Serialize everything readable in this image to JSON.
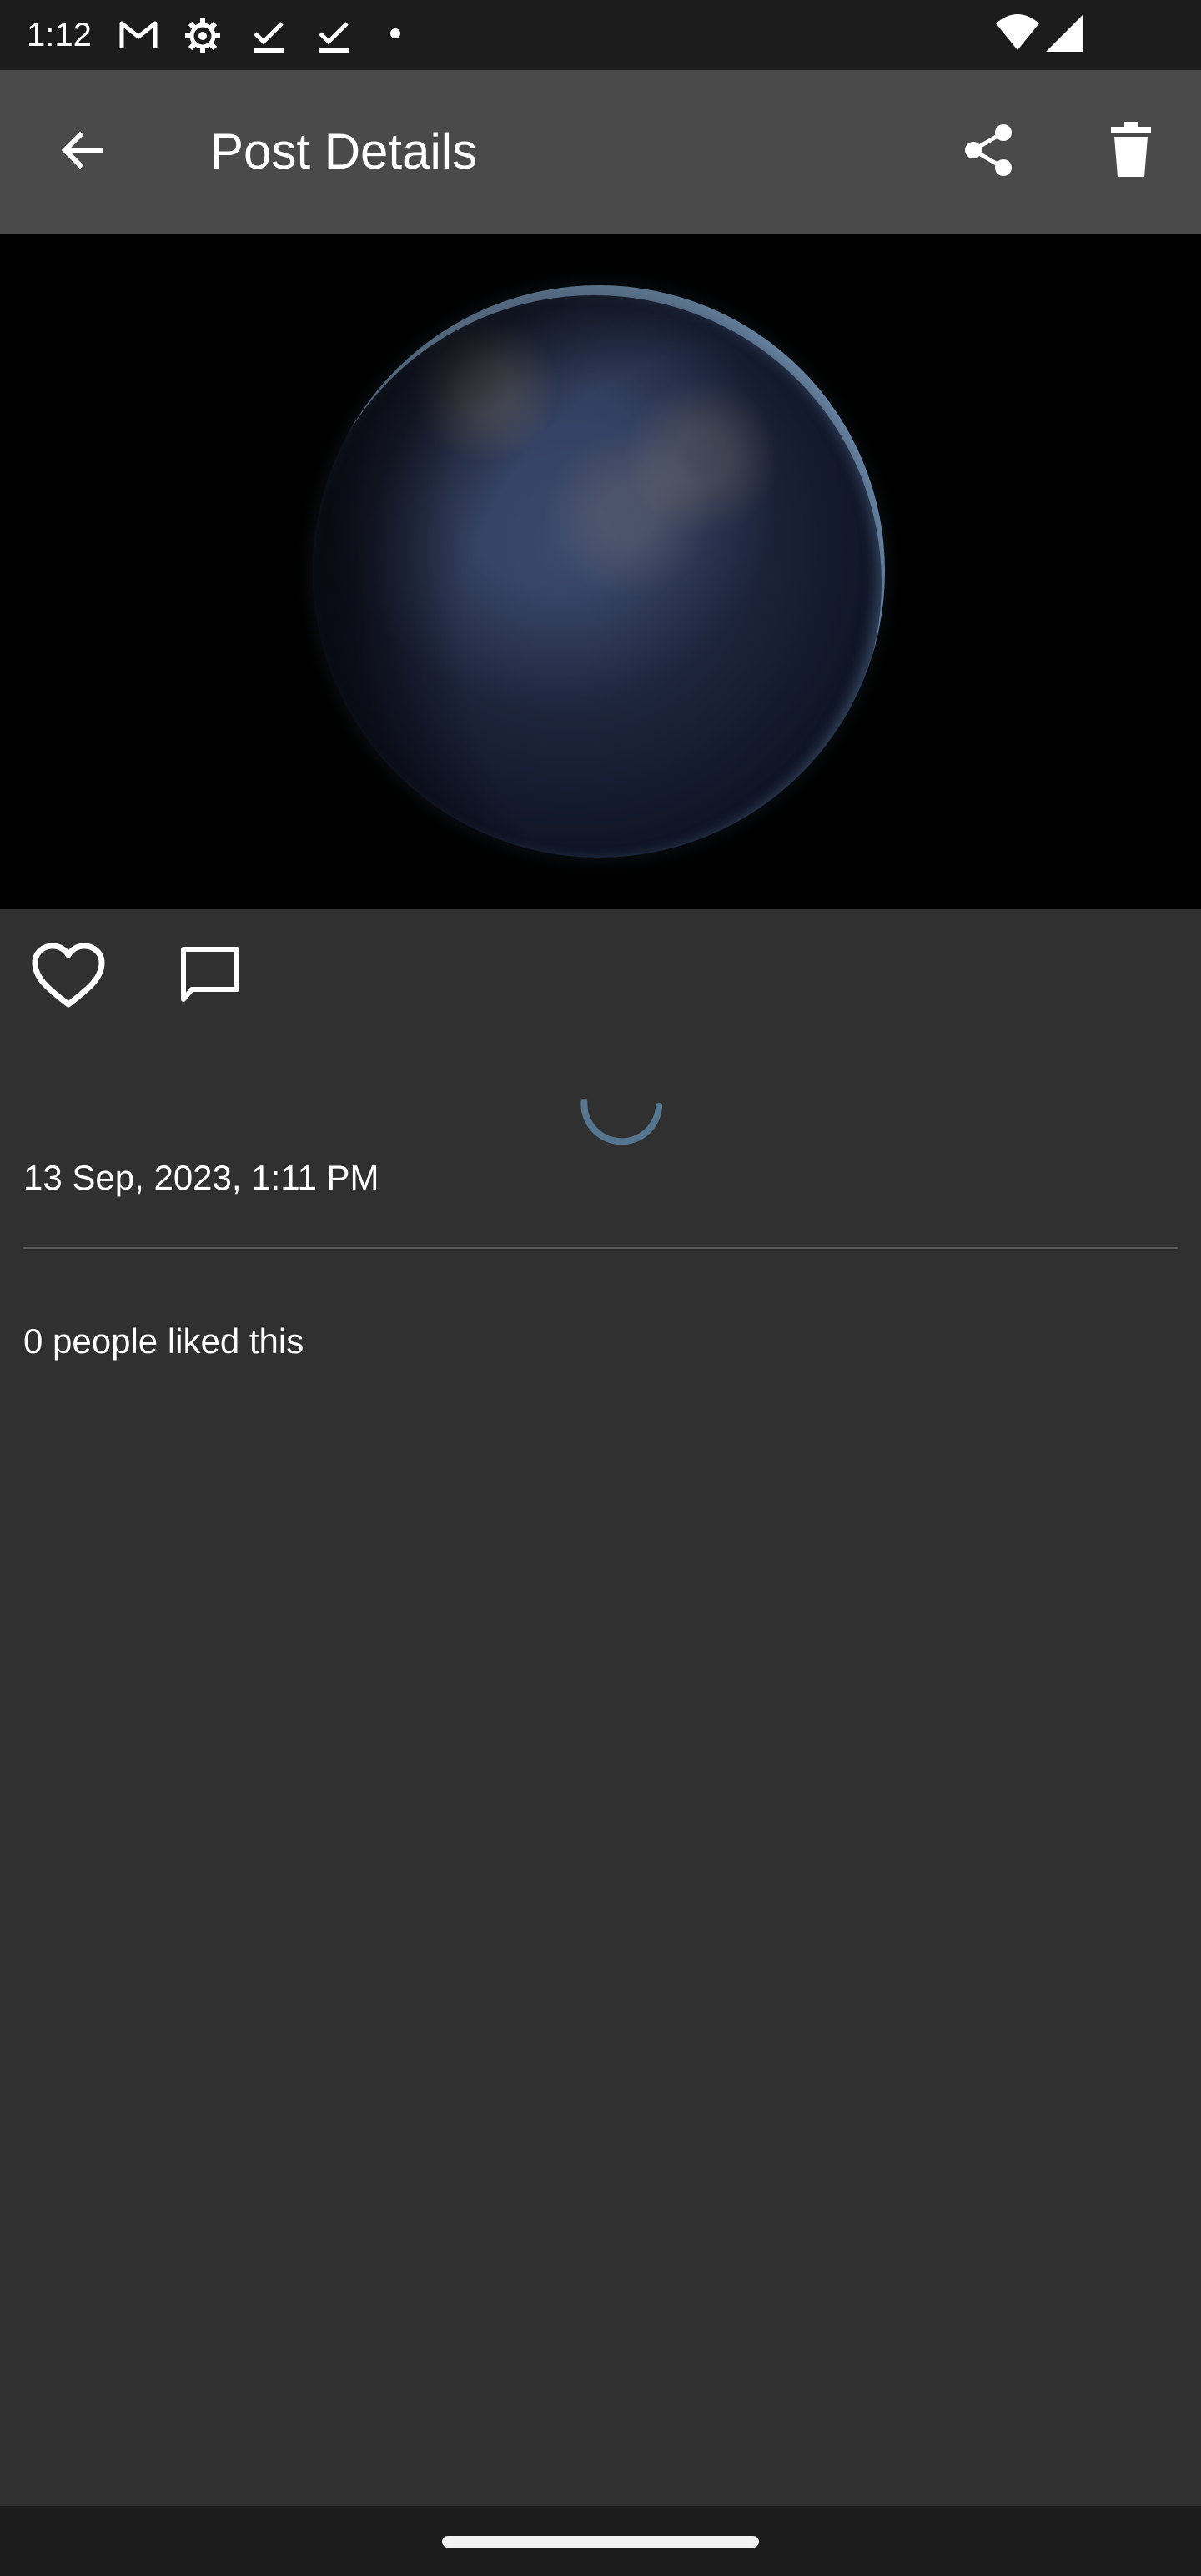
{
  "status_bar": {
    "time": "1:12",
    "icons": [
      "gmail-icon",
      "settings-icon",
      "download-done-icon",
      "download-done-icon",
      "notification-dot-icon",
      "wifi-icon",
      "signal-icon"
    ]
  },
  "app_bar": {
    "title": "Post Details",
    "back_icon": "back-arrow-icon",
    "share_icon": "share-icon",
    "delete_icon": "delete-icon"
  },
  "post": {
    "image_alt": "Earth at night",
    "like_icon": "heart-outline-icon",
    "comment_icon": "comment-icon",
    "loading": true,
    "timestamp": "13 Sep, 2023, 1:11 PM",
    "likes_text": "0 people liked this"
  },
  "colors": {
    "background": "#303030",
    "app_bar": "#4a4a4a",
    "status_bar": "#1c1c1c",
    "spinner": "#56758f",
    "divider": "#5a5a5a"
  }
}
